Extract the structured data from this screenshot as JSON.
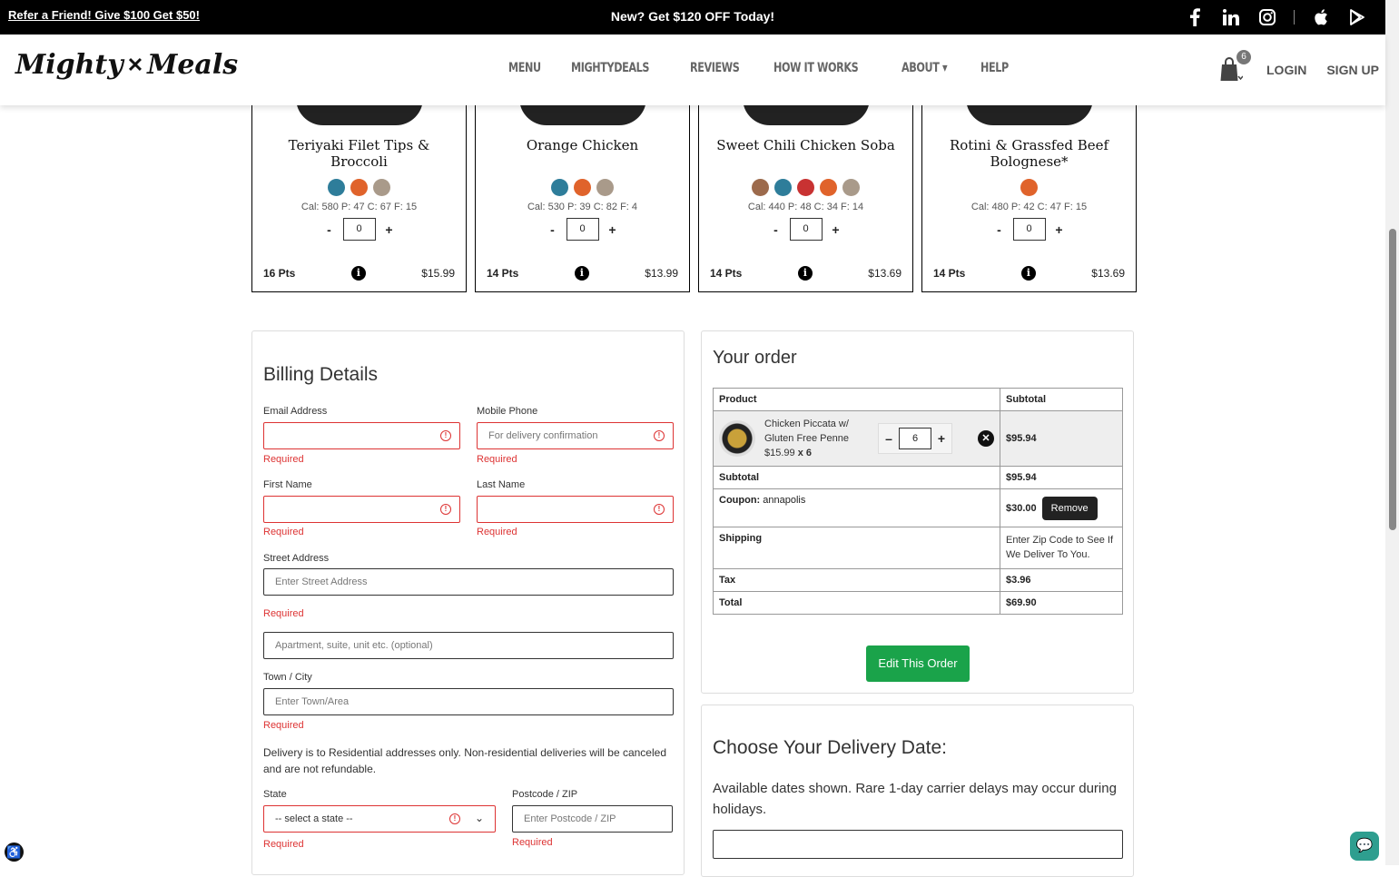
{
  "topbar": {
    "refer": "Refer a Friend! Give $100 Get $50!",
    "promo": "New? Get $120 OFF Today!",
    "social": [
      "facebook-icon",
      "linkedin-icon",
      "instagram-icon",
      "apple-icon",
      "google-play-icon"
    ]
  },
  "header": {
    "logo_left": "Mighty",
    "logo_right": "Meals",
    "nav": [
      "MENU",
      "MIGHTYDEALS",
      "REVIEWS",
      "HOW IT WORKS",
      "ABOUT ▾",
      "HELP"
    ],
    "cart_count": "6",
    "login": "LOGIN",
    "signup": "SIGN UP"
  },
  "products": [
    {
      "name": "Teriyaki Filet Tips & Broccoli",
      "macros": "Cal: 580  P: 47  C: 67  F: 15",
      "qty": "0",
      "pts": "16 Pts",
      "price": "$15.99",
      "icons": [
        "#2e7d9a",
        "#e0632b",
        "#a99a8a"
      ]
    },
    {
      "name": "Orange Chicken",
      "macros": "Cal: 530  P: 39  C: 82  F: 4",
      "qty": "0",
      "pts": "14 Pts",
      "price": "$13.99",
      "icons": [
        "#2e7d9a",
        "#e0632b",
        "#a99a8a"
      ]
    },
    {
      "name": "Sweet Chili Chicken Soba",
      "macros": "Cal: 440  P: 48  C: 34  F: 14",
      "qty": "0",
      "pts": "14 Pts",
      "price": "$13.69",
      "icons": [
        "#9c6a4c",
        "#2e7d9a",
        "#c83232",
        "#e0632b",
        "#a99a8a"
      ]
    },
    {
      "name": "Rotini & Grassfed Beef Bolognese*",
      "macros": "Cal: 480  P: 42  C: 47  F: 15",
      "qty": "0",
      "pts": "14 Pts",
      "price": "$13.69",
      "icons": [
        "#e0632b"
      ]
    }
  ],
  "billing": {
    "title": "Billing Details",
    "email_label": "Email Address",
    "mobile_label": "Mobile Phone",
    "mobile_placeholder": "For delivery confirmation",
    "first_label": "First Name",
    "last_label": "Last Name",
    "street_label": "Street Address",
    "street_placeholder": "Enter Street Address",
    "apt_placeholder": "Apartment, suite, unit etc. (optional)",
    "town_label": "Town / City",
    "town_placeholder": "Enter Town/Area",
    "required": "Required",
    "note": "Delivery is to Residential addresses only. Non-residential deliveries will be canceled and are not refundable.",
    "state_label": "State",
    "state_value": "-- select a state --",
    "zip_label": "Postcode / ZIP",
    "zip_placeholder": "Enter Postcode / ZIP"
  },
  "order": {
    "title": "Your order",
    "col_product": "Product",
    "col_subtotal": "Subtotal",
    "item_name": "Chicken Piccata w/ Gluten Free Penne",
    "item_price": "$15.99",
    "item_mult": "x 6",
    "item_qty": "6",
    "item_total": "$95.94",
    "subtotal_label": "Subtotal",
    "subtotal": "$95.94",
    "coupon_label": "Coupon:",
    "coupon_code": "annapolis",
    "coupon_amount": "$30.00",
    "remove": "Remove",
    "shipping_label": "Shipping",
    "shipping_value": "Enter Zip Code to See If We Deliver To You.",
    "tax_label": "Tax",
    "tax": "$3.96",
    "total_label": "Total",
    "total": "$69.90",
    "edit": "Edit This Order"
  },
  "delivery": {
    "title": "Choose Your Delivery Date:",
    "text": "Available dates shown. Rare 1-day carrier delays may occur during holidays."
  }
}
